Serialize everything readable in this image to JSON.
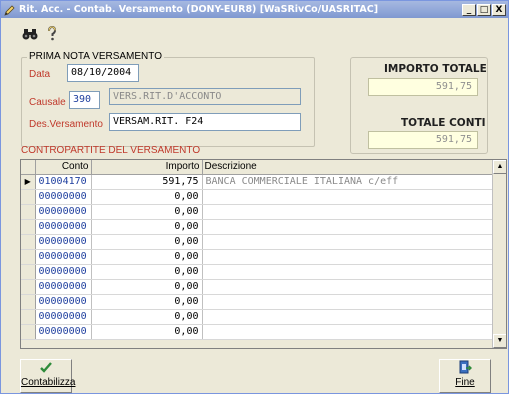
{
  "window": {
    "title": "Rit. Acc. - Contab. Versamento (DONY-EUR8) [WaSRivCo/UASRITAC]",
    "buttons": {
      "minimize": "_",
      "maximize": "□",
      "close": "X"
    }
  },
  "toolbar": {
    "search_icon": "binoculars-icon",
    "help_icon": "help-icon"
  },
  "prima_nota": {
    "group_label": "PRIMA NOTA VERSAMENTO",
    "data_label": "Data",
    "data_value": "08/10/2004",
    "causale_label": "Causale",
    "causale_code": "390",
    "causale_desc": "VERS.RIT.D'ACCONTO",
    "desversamento_label": "Des.Versamento",
    "desversamento_value": "VERSAM.RIT. F24"
  },
  "totals": {
    "importo_totale_label": "IMPORTO TOTALE",
    "importo_totale_value": "591,75",
    "totale_conti_label": "TOTALE CONTI",
    "totale_conti_value": "591,75"
  },
  "contropartite": {
    "section_label": "CONTROPARTITE DEL VERSAMENTO",
    "columns": [
      "Conto",
      "Importo",
      "Descrizione"
    ],
    "rows": [
      {
        "conto": "01004170",
        "importo": "591,75",
        "descrizione": "BANCA COMMERCIALE ITALIANA c/eff",
        "selected": true
      },
      {
        "conto": "00000000",
        "importo": "0,00",
        "descrizione": ""
      },
      {
        "conto": "00000000",
        "importo": "0,00",
        "descrizione": ""
      },
      {
        "conto": "00000000",
        "importo": "0,00",
        "descrizione": ""
      },
      {
        "conto": "00000000",
        "importo": "0,00",
        "descrizione": ""
      },
      {
        "conto": "00000000",
        "importo": "0,00",
        "descrizione": ""
      },
      {
        "conto": "00000000",
        "importo": "0,00",
        "descrizione": ""
      },
      {
        "conto": "00000000",
        "importo": "0,00",
        "descrizione": ""
      },
      {
        "conto": "00000000",
        "importo": "0,00",
        "descrizione": ""
      },
      {
        "conto": "00000000",
        "importo": "0,00",
        "descrizione": ""
      },
      {
        "conto": "00000000",
        "importo": "0,00",
        "descrizione": ""
      }
    ]
  },
  "actions": {
    "contabilizza_label": "Contabilizza",
    "fine_label": "Fine"
  },
  "colors": {
    "label_red": "#c0392b",
    "conto_blue": "#1f3f9f",
    "titlebar": "#8fa6d8"
  }
}
